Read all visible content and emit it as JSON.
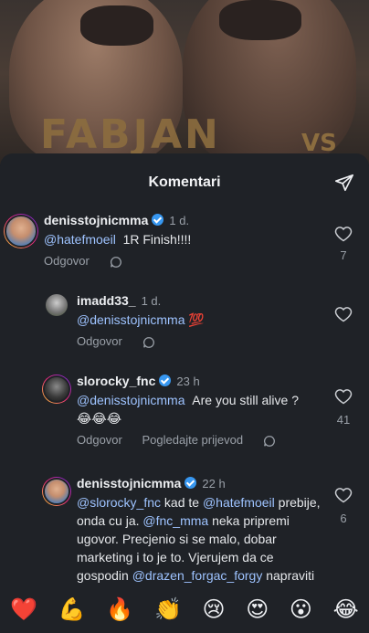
{
  "poster": {
    "headline": "FABJAN",
    "vs": "VS"
  },
  "sheet": {
    "title": "Komentari"
  },
  "comments": [
    {
      "username": "denisstojnicmma",
      "verified": true,
      "time": "1 d.",
      "mention": "@hatefmoeil",
      "text": "1R Finish!!!!",
      "reply_label": "Odgovor",
      "likes": "7"
    },
    {
      "username": "imadd33_",
      "verified": false,
      "time": "1 d.",
      "mention": "@denisstojnicmma",
      "text": "💯",
      "reply_label": "Odgovor",
      "likes": ""
    },
    {
      "username": "slorocky_fnc",
      "verified": true,
      "time": "23 h",
      "mention": "@denisstojnicmma",
      "text": "Are you still alive ?",
      "text2": "😂😂😂",
      "reply_label": "Odgovor",
      "translate_label": "Pogledajte prijevod",
      "likes": "41"
    },
    {
      "username": "denisstojnicmma",
      "verified": true,
      "time": "22 h",
      "mention": "@slorocky_fnc",
      "text_a": " kad te ",
      "mention2": "@hatefmoeil",
      "text_b": "prebije, onda cu ja. ",
      "mention3": "@fnc_mma",
      "text_c": " neka pripremi ugovor. Precjenio si se malo, dobar marketing i to je to. Vjerujem da ce gospodin ",
      "mention4": "@drazen_forgac_forgy",
      "text_d": " napraviti da se sto prije sretnemo u",
      "likes": "6"
    }
  ],
  "emoji_bar": [
    "❤️",
    "💪",
    "🔥",
    "👏",
    "😢",
    "😍",
    "😮",
    "😂"
  ]
}
